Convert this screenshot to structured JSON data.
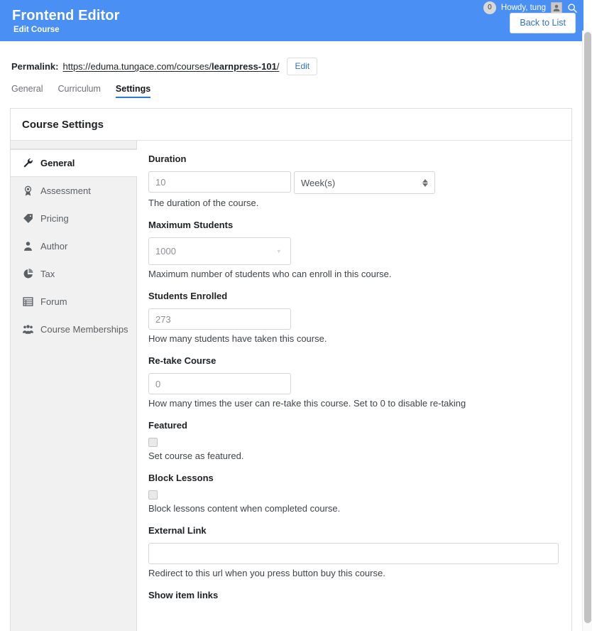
{
  "adminbar": {
    "comment_count": "0",
    "howdy": "Howdy, tung",
    "avatar_icon": "user-avatar-icon",
    "search_icon": "search-icon"
  },
  "header": {
    "title": "Frontend Editor",
    "subtitle": "Edit Course",
    "back_button": "Back to List",
    "background_color": "#4a90f4"
  },
  "permalink": {
    "label": "Permalink:",
    "url_prefix": "https://eduma.tungace.com/courses/",
    "url_slug": "learnpress-101",
    "url_suffix": "/",
    "edit_button": "Edit"
  },
  "tabs": [
    {
      "label": "General",
      "active": false
    },
    {
      "label": "Curriculum",
      "active": false
    },
    {
      "label": "Settings",
      "active": true
    }
  ],
  "panel": {
    "title": "Course Settings"
  },
  "sidebar": {
    "items": [
      {
        "label": "General",
        "icon": "wrench-icon",
        "active": true
      },
      {
        "label": "Assessment",
        "icon": "award-badge-icon",
        "active": false
      },
      {
        "label": "Pricing",
        "icon": "price-tag-icon",
        "active": false
      },
      {
        "label": "Author",
        "icon": "user-icon",
        "active": false
      },
      {
        "label": "Tax",
        "icon": "pie-chart-icon",
        "active": false
      },
      {
        "label": "Forum",
        "icon": "list-table-icon",
        "active": false
      },
      {
        "label": "Course Memberships",
        "icon": "users-group-icon",
        "active": false
      }
    ]
  },
  "form": {
    "duration": {
      "label": "Duration",
      "value": "10",
      "unit": "Week(s)",
      "description": "The duration of the course."
    },
    "maximum_students": {
      "label": "Maximum Students",
      "value": "1000",
      "description": "Maximum number of students who can enroll in this course."
    },
    "students_enrolled": {
      "label": "Students Enrolled",
      "value": "273",
      "description": "How many students have taken this course."
    },
    "retake_course": {
      "label": "Re-take Course",
      "value": "0",
      "description": "How many times the user can re-take this course. Set to 0 to disable re-taking"
    },
    "featured": {
      "label": "Featured",
      "checked": false,
      "description": "Set course as featured."
    },
    "block_lessons": {
      "label": "Block Lessons",
      "checked": false,
      "description": "Block lessons content when completed course."
    },
    "external_link": {
      "label": "External Link",
      "value": "",
      "description": "Redirect to this url when you press button buy this course."
    },
    "show_item_links": {
      "label": "Show item links"
    }
  }
}
